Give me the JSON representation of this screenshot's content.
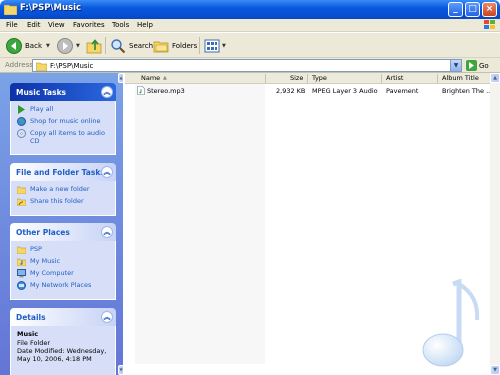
{
  "window": {
    "title": "F:\\PSP\\Music",
    "minimize_label": "_",
    "maximize_label": "□",
    "close_label": "×"
  },
  "menu": {
    "items": [
      {
        "label": "File"
      },
      {
        "label": "Edit"
      },
      {
        "label": "View"
      },
      {
        "label": "Favorites"
      },
      {
        "label": "Tools"
      },
      {
        "label": "Help"
      }
    ]
  },
  "toolbar": {
    "back_label": "Back",
    "search_label": "Search",
    "folders_label": "Folders"
  },
  "address": {
    "label": "Address",
    "value": "F:\\PSP\\Music",
    "go_label": "Go"
  },
  "taskpane": {
    "music_tasks": {
      "title": "Music Tasks",
      "items": [
        {
          "label": "Play all"
        },
        {
          "label": "Shop for music online"
        },
        {
          "label": "Copy all items to audio CD"
        }
      ]
    },
    "file_folder_tasks": {
      "title": "File and Folder Tasks",
      "items": [
        {
          "label": "Make a new folder"
        },
        {
          "label": "Share this folder"
        }
      ]
    },
    "other_places": {
      "title": "Other Places",
      "items": [
        {
          "label": "PSP"
        },
        {
          "label": "My Music"
        },
        {
          "label": "My Computer"
        },
        {
          "label": "My Network Places"
        }
      ]
    },
    "details": {
      "title": "Details",
      "name": "Music",
      "type": "File Folder",
      "modified": "Date Modified: Wednesday, May 10, 2006, 4:18 PM"
    }
  },
  "filelist": {
    "columns": [
      "Name",
      "Size",
      "Type",
      "Artist",
      "Album Title"
    ],
    "rows": [
      {
        "name": "Stereo.mp3",
        "size": "2,932 KB",
        "type": "MPEG Layer 3 Audio",
        "artist": "Pavement",
        "album": "Brighten The ..."
      }
    ]
  },
  "colors": {
    "titlebar": "#0a5ae0",
    "taskpane": "#7ba2e7",
    "link": "#215dc6"
  }
}
